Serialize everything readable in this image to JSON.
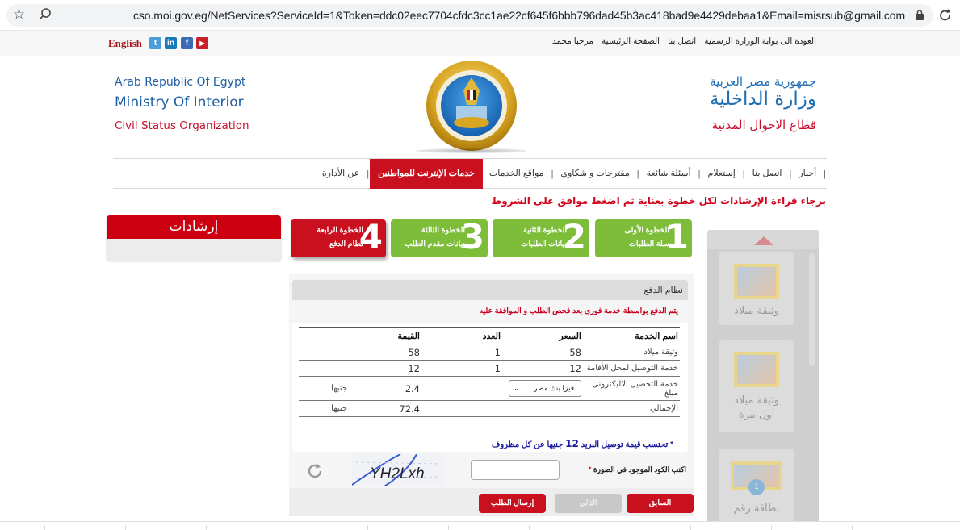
{
  "browser": {
    "url": "cso.moi.gov.eg/NetServices?ServiceId=1&Token=ddc02eec7704cfdc3cc1ae22cf645f6bbb796dad45b3ac418bad9e4429debaa1&Email=misrsub@gmail.com",
    "icons": [
      "star-icon",
      "zoom-icon",
      "lock-icon",
      "reload-icon"
    ]
  },
  "topbar": {
    "language_link": "English",
    "social": [
      {
        "name": "twitter",
        "glyph": "t",
        "color": "#4a9fd8"
      },
      {
        "name": "linkedin",
        "glyph": "in",
        "color": "#1a7ab8"
      },
      {
        "name": "facebook",
        "glyph": "f",
        "color": "#3d6bb3"
      },
      {
        "name": "youtube",
        "glyph": "▶",
        "color": "#c8202a"
      }
    ],
    "links": [
      "مرحبا محمد",
      "الصفحة الرئيسية",
      "اتصل بنا",
      "العودة الى بوابة الوزارة الرسمية"
    ]
  },
  "header": {
    "en_line1": "Arab Republic Of Egypt",
    "en_line2": "Ministry Of Interior",
    "en_line3": "Civil Status Organization",
    "ar_line1": "جمهورية مصر العربية",
    "ar_line2": "وزارة الداخلية",
    "ar_line3": "قطاع الاحوال المدنية"
  },
  "nav": {
    "items": [
      {
        "label": "عن الأدارة",
        "active": false
      },
      {
        "label": "خدمات الإنترنت للمواطنين",
        "active": true
      },
      {
        "label": "مواقع الخدمات",
        "active": false
      },
      {
        "label": "مقترحات و شكاوي",
        "active": false
      },
      {
        "label": "أسئلة شائعة",
        "active": false
      },
      {
        "label": "إستعلام",
        "active": false
      },
      {
        "label": "اتصل بنا",
        "active": false
      },
      {
        "label": "أخبار",
        "active": false
      }
    ]
  },
  "notice": "برجاء قراءة الإرشادات لكل خطوة بعناية ثم اضغط موافق على الشروط",
  "guide": {
    "title": "إرشادات"
  },
  "steps": [
    {
      "number": "1",
      "title": "الخطوة الأولى",
      "subtitle": "سلة الطلبات",
      "state": "done"
    },
    {
      "number": "2",
      "title": "الخطوة الثانية",
      "subtitle": "بيانات الطلبات",
      "state": "done"
    },
    {
      "number": "3",
      "title": "الخطوة الثالثة",
      "subtitle": "بيانات مقدم الطلب",
      "state": "done"
    },
    {
      "number": "4",
      "title": "الخطوة الرابعة",
      "subtitle": "نظام الدفع",
      "state": "current"
    }
  ],
  "payment": {
    "title": "نظام الدفع",
    "note": "يتم الدفع بواسطة خدمة فورى بعد فحص الطلب و الموافقة عليه",
    "columns": [
      "اسم الخدمة",
      "السعر",
      "العدد",
      "القيمة"
    ],
    "rows": [
      {
        "service": "وثيقة ميلاد",
        "price": "58",
        "count": "1",
        "value": "58",
        "unit": ""
      },
      {
        "service": "خدمة التوصيل لمحل الأقامة",
        "price": "12",
        "count": "1",
        "value": "12",
        "unit": ""
      }
    ],
    "e_fee": {
      "label": "خدمة التحصيل الاليكترونى مبلغ",
      "selected_method": "فيزا بنك مصر",
      "value": "2.4",
      "unit": "جنيها"
    },
    "total": {
      "label": "الإجمالي",
      "value": "72.4",
      "unit": "جنيها"
    },
    "postal_note_prefix": "* تحتسب قيمة توصيل البريد",
    "postal_note_amount": "12",
    "postal_note_suffix": "جنيها عن كل مظروف"
  },
  "captcha": {
    "label": "اكتب الكود الموجود في الصورة",
    "required_mark": "*",
    "input_value": "",
    "image_text": "YH2Lxh"
  },
  "buttons": {
    "previous": "السابق",
    "next": "التالي",
    "submit": "إرسال الطلب"
  },
  "service_slider": {
    "items": [
      {
        "label": "وثيقة ميلاد"
      },
      {
        "label": "وثيقة ميلاد اول مرة"
      },
      {
        "label": "بطاقة رقم",
        "badge": "1"
      }
    ]
  }
}
